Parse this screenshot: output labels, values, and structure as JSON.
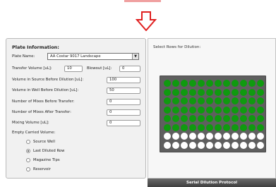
{
  "plate_info": {
    "title": "Plate Information:",
    "plate_name_label": "Plate Name:",
    "plate_name_value": "AA Costar 9017 Landscape",
    "transfer_volume_label": "Transfer Volume [uL]:",
    "transfer_volume_value": "10",
    "blowout_label": "Blowout [uL]:",
    "blowout_value": "0",
    "vol_source_label": "Volume in Source Before Dilution [uL]:",
    "vol_source_value": "100",
    "vol_well_label": "Volume in Well Before Dilution [uL]:",
    "vol_well_value": "50",
    "mixes_before_label": "Number of Mixes Before Transfer:",
    "mixes_before_value": "0",
    "mixes_after_label": "Number of Mixes After Transfer:",
    "mixes_after_value": "0",
    "mixing_volume_label": "Mixing Volume [uL]:",
    "mixing_volume_value": "0",
    "empty_label": "Empty Carried Volume:",
    "radio_options": [
      "Source Well",
      "Last Diluted Row",
      "Magazine Tips",
      "Reservoir"
    ],
    "selected_option": "Last Diluted Row"
  },
  "rows_panel": {
    "label": "Select Rows for Dilution:",
    "plate": {
      "columns": 12,
      "rows": 8,
      "filled_rows": 6
    }
  },
  "footer": {
    "title": "Serial Dilution Protocol"
  },
  "colors": {
    "well_filled": "#0f9a0f",
    "well_empty": "#ffffff",
    "plate": "#5f5f5f",
    "arrow": "#e02020"
  },
  "icons": {
    "arrow": "down-arrow-icon",
    "dropdown": "chevron-down-icon"
  }
}
